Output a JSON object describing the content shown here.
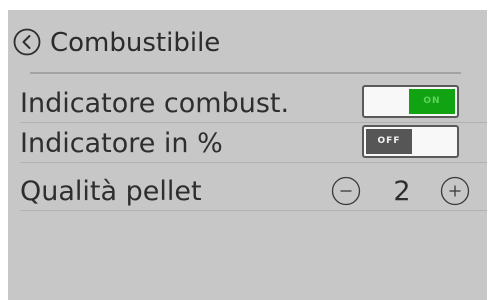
{
  "header": {
    "title": "Combustibile"
  },
  "settings": {
    "fuel_indicator": {
      "label": "Indicatore combust.",
      "state": "ON"
    },
    "percent_indicator": {
      "label": "Indicatore in %",
      "state": "OFF"
    },
    "pellet_quality": {
      "label": "Qualità pellet",
      "value": "2"
    }
  },
  "colors": {
    "panel_background": "#c7c7c7",
    "text": "#2e2e2e",
    "toggle_on": "#12a312",
    "toggle_off": "#565656"
  },
  "icons": {
    "back": "chevron-left-circle-icon",
    "decrement": "minus-circle-icon",
    "increment": "plus-circle-icon"
  }
}
